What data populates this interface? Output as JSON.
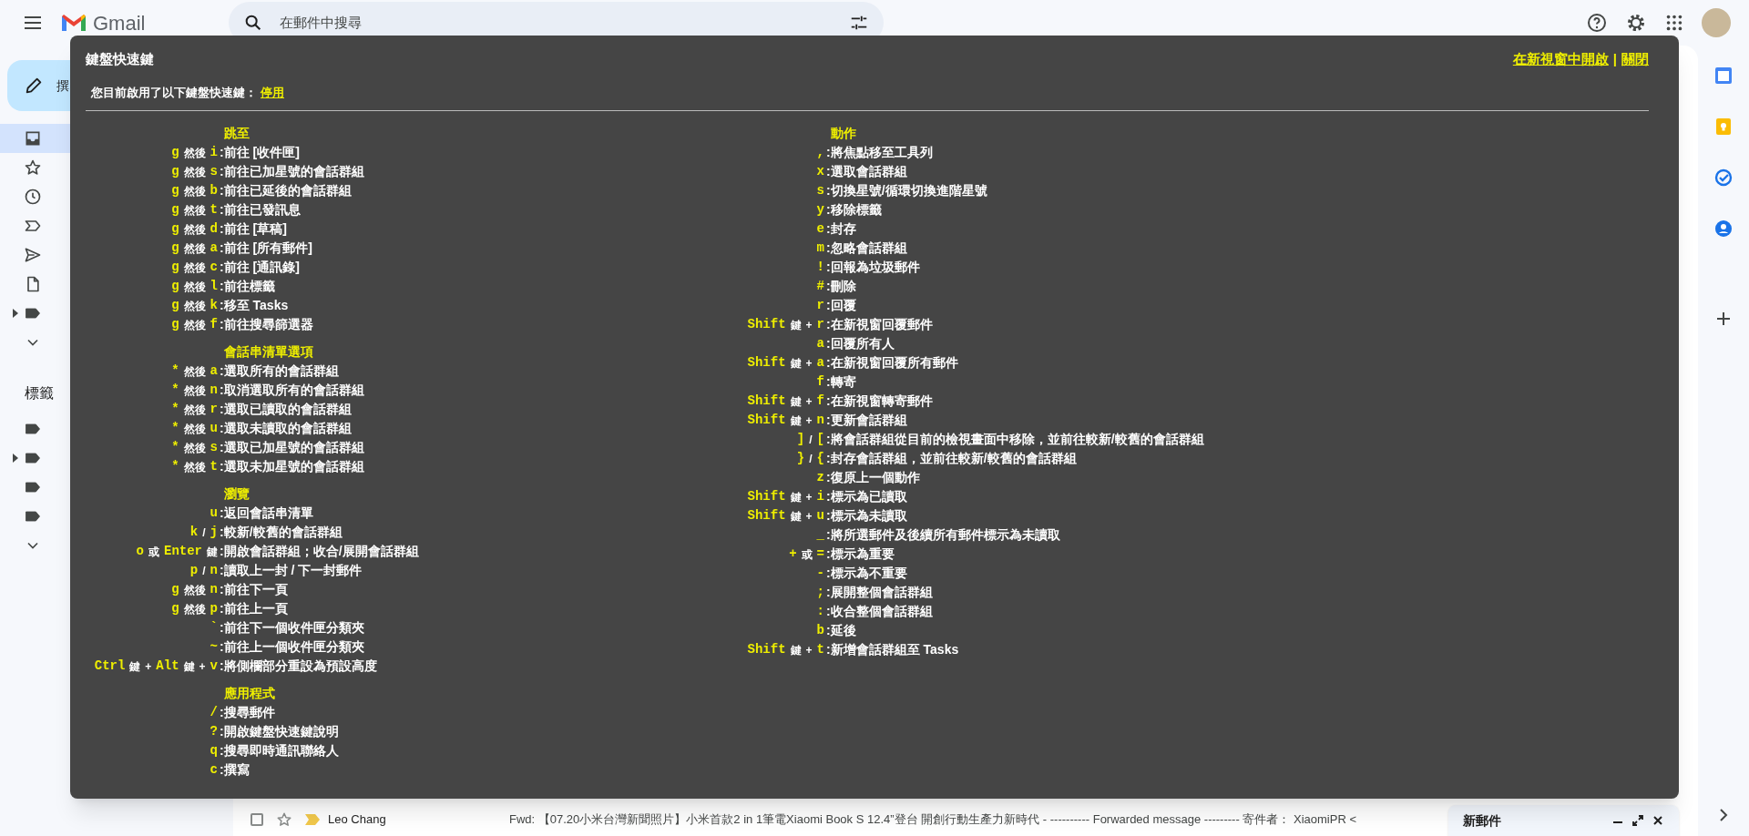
{
  "header": {
    "app_name": "Gmail",
    "search": {
      "placeholder": "在郵件中搜尋"
    },
    "actions": [
      {
        "kind": "help"
      },
      {
        "kind": "settings"
      },
      {
        "kind": "apps"
      },
      {
        "kind": "avatar"
      }
    ]
  },
  "compose_button": {
    "label": "撰"
  },
  "sidebar": {
    "items": [
      {
        "kind": "inbox",
        "selected": true,
        "expandable": false
      },
      {
        "kind": "star",
        "selected": false,
        "expandable": false
      },
      {
        "kind": "clock",
        "selected": false,
        "expandable": false
      },
      {
        "kind": "important",
        "selected": false,
        "expandable": false
      },
      {
        "kind": "send",
        "selected": false,
        "expandable": false
      },
      {
        "kind": "draft",
        "selected": false,
        "expandable": false
      },
      {
        "kind": "label",
        "selected": false,
        "expandable": true
      },
      {
        "kind": "more",
        "selected": false,
        "expandable": false
      }
    ],
    "labels_heading": "標籤",
    "labels": [
      {
        "kind": "label",
        "expandable": false
      },
      {
        "kind": "label",
        "expandable": true
      },
      {
        "kind": "label",
        "expandable": false
      },
      {
        "kind": "label",
        "expandable": false
      },
      {
        "kind": "more",
        "expandable": false
      }
    ]
  },
  "bottom_email": {
    "checked": false,
    "starred": false,
    "important": true,
    "sender": "Leo Chang",
    "snippet": "Fwd: 【07.20小米台灣新聞照片】小米首款2 in 1筆電Xiaomi Book S 12.4”登台 開創行動生產力新時代 - ---------- Forwarded message --------- 寄件者： XiaomiPR <"
  },
  "right_rail": [
    {
      "kind": "calendar"
    },
    {
      "kind": "keep"
    },
    {
      "kind": "tasks"
    },
    {
      "kind": "contacts"
    },
    {
      "kind": "add"
    }
  ],
  "compose_window": {
    "title": "新郵件"
  },
  "shortcuts_dialog": {
    "title": "鍵盤快速鍵",
    "status_text": "您目前啟用了以下鍵盤快速鍵：",
    "disable_link": "停用",
    "open_link": "在新視窗中開啟",
    "link_separator": "|",
    "close_link": "關閉",
    "columns": [
      [
        {
          "heading": "跳至",
          "shortcuts": [
            {
              "keys": [
                {
                  "kind": "key",
                  "text": "g"
                },
                {
                  "kind": "text",
                  "text": "然後"
                },
                {
                  "kind": "key",
                  "text": "i"
                }
              ],
              "action": ":前往 [收件匣]"
            },
            {
              "keys": [
                {
                  "kind": "key",
                  "text": "g"
                },
                {
                  "kind": "text",
                  "text": "然後"
                },
                {
                  "kind": "key",
                  "text": "s"
                }
              ],
              "action": ":前往已加星號的會話群組"
            },
            {
              "keys": [
                {
                  "kind": "key",
                  "text": "g"
                },
                {
                  "kind": "text",
                  "text": "然後"
                },
                {
                  "kind": "key",
                  "text": "b"
                }
              ],
              "action": ":前往已延後的會話群組"
            },
            {
              "keys": [
                {
                  "kind": "key",
                  "text": "g"
                },
                {
                  "kind": "text",
                  "text": "然後"
                },
                {
                  "kind": "key",
                  "text": "t"
                }
              ],
              "action": ":前往已發訊息"
            },
            {
              "keys": [
                {
                  "kind": "key",
                  "text": "g"
                },
                {
                  "kind": "text",
                  "text": "然後"
                },
                {
                  "kind": "key",
                  "text": "d"
                }
              ],
              "action": ":前往 [草稿]"
            },
            {
              "keys": [
                {
                  "kind": "key",
                  "text": "g"
                },
                {
                  "kind": "text",
                  "text": "然後"
                },
                {
                  "kind": "key",
                  "text": "a"
                }
              ],
              "action": ":前往 [所有郵件]"
            },
            {
              "keys": [
                {
                  "kind": "key",
                  "text": "g"
                },
                {
                  "kind": "text",
                  "text": "然後"
                },
                {
                  "kind": "key",
                  "text": "c"
                }
              ],
              "action": ":前往 [通訊錄]"
            },
            {
              "keys": [
                {
                  "kind": "key",
                  "text": "g"
                },
                {
                  "kind": "text",
                  "text": "然後"
                },
                {
                  "kind": "key",
                  "text": "l"
                }
              ],
              "action": ":前往標籤"
            },
            {
              "keys": [
                {
                  "kind": "key",
                  "text": "g"
                },
                {
                  "kind": "text",
                  "text": "然後"
                },
                {
                  "kind": "key",
                  "text": "k"
                }
              ],
              "action": ":移至 Tasks"
            },
            {
              "keys": [
                {
                  "kind": "key",
                  "text": "g"
                },
                {
                  "kind": "text",
                  "text": "然後"
                },
                {
                  "kind": "key",
                  "text": "f"
                }
              ],
              "action": ":前往搜尋篩選器"
            }
          ]
        },
        {
          "heading": "會話串清單選項",
          "shortcuts": [
            {
              "keys": [
                {
                  "kind": "key",
                  "text": "*"
                },
                {
                  "kind": "text",
                  "text": "然後"
                },
                {
                  "kind": "key",
                  "text": "a"
                }
              ],
              "action": ":選取所有的會話群組"
            },
            {
              "keys": [
                {
                  "kind": "key",
                  "text": "*"
                },
                {
                  "kind": "text",
                  "text": "然後"
                },
                {
                  "kind": "key",
                  "text": "n"
                }
              ],
              "action": ":取消選取所有的會話群組"
            },
            {
              "keys": [
                {
                  "kind": "key",
                  "text": "*"
                },
                {
                  "kind": "text",
                  "text": "然後"
                },
                {
                  "kind": "key",
                  "text": "r"
                }
              ],
              "action": ":選取已讀取的會話群組"
            },
            {
              "keys": [
                {
                  "kind": "key",
                  "text": "*"
                },
                {
                  "kind": "text",
                  "text": "然後"
                },
                {
                  "kind": "key",
                  "text": "u"
                }
              ],
              "action": ":選取未讀取的會話群組"
            },
            {
              "keys": [
                {
                  "kind": "key",
                  "text": "*"
                },
                {
                  "kind": "text",
                  "text": "然後"
                },
                {
                  "kind": "key",
                  "text": "s"
                }
              ],
              "action": ":選取已加星號的會話群組"
            },
            {
              "keys": [
                {
                  "kind": "key",
                  "text": "*"
                },
                {
                  "kind": "text",
                  "text": "然後"
                },
                {
                  "kind": "key",
                  "text": "t"
                }
              ],
              "action": ":選取未加星號的會話群組"
            }
          ]
        },
        {
          "heading": "瀏覽",
          "shortcuts": [
            {
              "keys": [
                {
                  "kind": "key",
                  "text": "u"
                }
              ],
              "action": ":返回會話串清單"
            },
            {
              "keys": [
                {
                  "kind": "key",
                  "text": "k"
                },
                {
                  "kind": "text",
                  "text": "/"
                },
                {
                  "kind": "key",
                  "text": "j"
                }
              ],
              "action": ":較新/較舊的會話群組"
            },
            {
              "keys": [
                {
                  "kind": "key",
                  "text": "o"
                },
                {
                  "kind": "text",
                  "text": "或"
                },
                {
                  "kind": "key",
                  "text": "Enter"
                },
                {
                  "kind": "text",
                  "text": "鍵"
                }
              ],
              "action": ":開啟會話群組；收合/展開會話群組"
            },
            {
              "keys": [
                {
                  "kind": "key",
                  "text": "p"
                },
                {
                  "kind": "text",
                  "text": "/"
                },
                {
                  "kind": "key",
                  "text": "n"
                }
              ],
              "action": ":讀取上一封 / 下一封郵件"
            },
            {
              "keys": [
                {
                  "kind": "key",
                  "text": "g"
                },
                {
                  "kind": "text",
                  "text": "然後"
                },
                {
                  "kind": "key",
                  "text": "n"
                }
              ],
              "action": ":前往下一頁"
            },
            {
              "keys": [
                {
                  "kind": "key",
                  "text": "g"
                },
                {
                  "kind": "text",
                  "text": "然後"
                },
                {
                  "kind": "key",
                  "text": "p"
                }
              ],
              "action": ":前往上一頁"
            },
            {
              "keys": [
                {
                  "kind": "key",
                  "text": "`"
                }
              ],
              "action": ":前往下一個收件匣分類夾"
            },
            {
              "keys": [
                {
                  "kind": "key",
                  "text": "~"
                }
              ],
              "action": ":前往上一個收件匣分類夾"
            },
            {
              "keys": [
                {
                  "kind": "key",
                  "text": "Ctrl"
                },
                {
                  "kind": "text",
                  "text": "鍵"
                },
                {
                  "kind": "text",
                  "text": "+"
                },
                {
                  "kind": "key",
                  "text": "Alt"
                },
                {
                  "kind": "text",
                  "text": "鍵"
                },
                {
                  "kind": "text",
                  "text": "+"
                },
                {
                  "kind": "key",
                  "text": "v"
                }
              ],
              "action": ":將側欄部分重設為預設高度"
            }
          ]
        },
        {
          "heading": "應用程式",
          "shortcuts": [
            {
              "keys": [
                {
                  "kind": "key",
                  "text": "/"
                }
              ],
              "action": ":搜尋郵件"
            },
            {
              "keys": [
                {
                  "kind": "key",
                  "text": "?"
                }
              ],
              "action": ":開啟鍵盤快速鍵說明"
            },
            {
              "keys": [
                {
                  "kind": "key",
                  "text": "q"
                }
              ],
              "action": ":搜尋即時通訊聯絡人"
            },
            {
              "keys": [
                {
                  "kind": "key",
                  "text": "c"
                }
              ],
              "action": ":撰寫"
            }
          ]
        }
      ],
      [
        {
          "heading": "動作",
          "shortcuts": [
            {
              "keys": [
                {
                  "kind": "key",
                  "text": ","
                }
              ],
              "action": ":將焦點移至工具列"
            },
            {
              "keys": [
                {
                  "kind": "key",
                  "text": "x"
                }
              ],
              "action": ":選取會話群組"
            },
            {
              "keys": [
                {
                  "kind": "key",
                  "text": "s"
                }
              ],
              "action": ":切換星號/循環切換進階星號"
            },
            {
              "keys": [
                {
                  "kind": "key",
                  "text": "y"
                }
              ],
              "action": ":移除標籤"
            },
            {
              "keys": [
                {
                  "kind": "key",
                  "text": "e"
                }
              ],
              "action": ":封存"
            },
            {
              "keys": [
                {
                  "kind": "key",
                  "text": "m"
                }
              ],
              "action": ":忽略會話群組"
            },
            {
              "keys": [
                {
                  "kind": "key",
                  "text": "!"
                }
              ],
              "action": ":回報為垃圾郵件"
            },
            {
              "keys": [
                {
                  "kind": "key",
                  "text": "#"
                }
              ],
              "action": ":刪除"
            },
            {
              "keys": [
                {
                  "kind": "key",
                  "text": "r"
                }
              ],
              "action": ":回覆"
            },
            {
              "keys": [
                {
                  "kind": "key",
                  "text": "Shift"
                },
                {
                  "kind": "text",
                  "text": "鍵"
                },
                {
                  "kind": "text",
                  "text": "+"
                },
                {
                  "kind": "key",
                  "text": "r"
                }
              ],
              "action": ":在新視窗回覆郵件"
            },
            {
              "keys": [
                {
                  "kind": "key",
                  "text": "a"
                }
              ],
              "action": ":回覆所有人"
            },
            {
              "keys": [
                {
                  "kind": "key",
                  "text": "Shift"
                },
                {
                  "kind": "text",
                  "text": "鍵"
                },
                {
                  "kind": "text",
                  "text": "+"
                },
                {
                  "kind": "key",
                  "text": "a"
                }
              ],
              "action": ":在新視窗回覆所有郵件"
            },
            {
              "keys": [
                {
                  "kind": "key",
                  "text": "f"
                }
              ],
              "action": ":轉寄"
            },
            {
              "keys": [
                {
                  "kind": "key",
                  "text": "Shift"
                },
                {
                  "kind": "text",
                  "text": "鍵"
                },
                {
                  "kind": "text",
                  "text": "+"
                },
                {
                  "kind": "key",
                  "text": "f"
                }
              ],
              "action": ":在新視窗轉寄郵件"
            },
            {
              "keys": [
                {
                  "kind": "key",
                  "text": "Shift"
                },
                {
                  "kind": "text",
                  "text": "鍵"
                },
                {
                  "kind": "text",
                  "text": "+"
                },
                {
                  "kind": "key",
                  "text": "n"
                }
              ],
              "action": ":更新會話群組"
            },
            {
              "keys": [
                {
                  "kind": "key",
                  "text": "]"
                },
                {
                  "kind": "text",
                  "text": "/"
                },
                {
                  "kind": "key",
                  "text": "["
                }
              ],
              "action": ":將會話群組從目前的檢視畫面中移除，並前往較新/較舊的會話群組"
            },
            {
              "keys": [
                {
                  "kind": "key",
                  "text": "}"
                },
                {
                  "kind": "text",
                  "text": "/"
                },
                {
                  "kind": "key",
                  "text": "{"
                }
              ],
              "action": ":封存會話群組，並前往較新/較舊的會話群組"
            },
            {
              "keys": [
                {
                  "kind": "key",
                  "text": "z"
                }
              ],
              "action": ":復原上一個動作"
            },
            {
              "keys": [
                {
                  "kind": "key",
                  "text": "Shift"
                },
                {
                  "kind": "text",
                  "text": "鍵"
                },
                {
                  "kind": "text",
                  "text": "+"
                },
                {
                  "kind": "key",
                  "text": "i"
                }
              ],
              "action": ":標示為已讀取"
            },
            {
              "keys": [
                {
                  "kind": "key",
                  "text": "Shift"
                },
                {
                  "kind": "text",
                  "text": "鍵"
                },
                {
                  "kind": "text",
                  "text": "+"
                },
                {
                  "kind": "key",
                  "text": "u"
                }
              ],
              "action": ":標示為未讀取"
            },
            {
              "keys": [
                {
                  "kind": "key",
                  "text": "_"
                }
              ],
              "action": ":將所選郵件及後續所有郵件標示為未讀取"
            },
            {
              "keys": [
                {
                  "kind": "key",
                  "text": "+"
                },
                {
                  "kind": "text",
                  "text": "或"
                },
                {
                  "kind": "key",
                  "text": "="
                }
              ],
              "action": ":標示為重要"
            },
            {
              "keys": [
                {
                  "kind": "key",
                  "text": "-"
                }
              ],
              "action": ":標示為不重要"
            },
            {
              "keys": [
                {
                  "kind": "key",
                  "text": ";"
                }
              ],
              "action": ":展開整個會話群組"
            },
            {
              "keys": [
                {
                  "kind": "key",
                  "text": ":"
                }
              ],
              "action": ":收合整個會話群組"
            },
            {
              "keys": [
                {
                  "kind": "key",
                  "text": "b"
                }
              ],
              "action": ":延後"
            },
            {
              "keys": [
                {
                  "kind": "key",
                  "text": "Shift"
                },
                {
                  "kind": "text",
                  "text": "鍵"
                },
                {
                  "kind": "text",
                  "text": "+"
                },
                {
                  "kind": "key",
                  "text": "t"
                }
              ],
              "action": ":新增會話群組至 Tasks"
            }
          ]
        }
      ]
    ]
  }
}
